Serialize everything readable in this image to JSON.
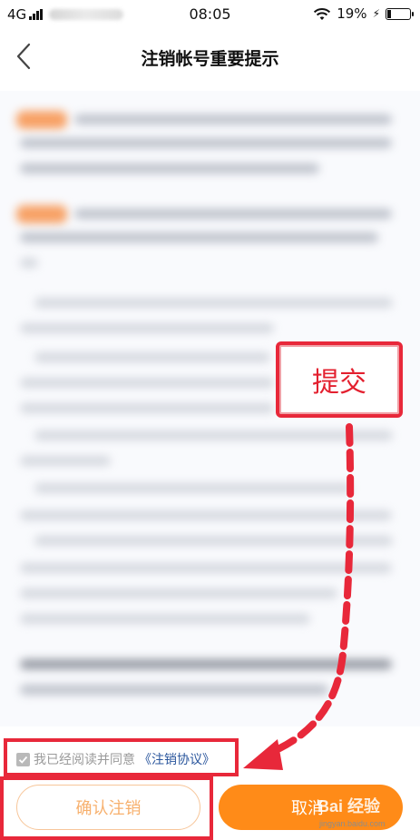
{
  "status_bar": {
    "network": "4G",
    "time": "08:05",
    "battery": "19%",
    "battery_level": 0.19
  },
  "nav": {
    "title": "注销帐号重要提示"
  },
  "annotation": {
    "label": "提交"
  },
  "agreement": {
    "checked": true,
    "text": "我已经阅读并同意",
    "link": "《注销协议》"
  },
  "buttons": {
    "confirm": "确认注销",
    "cancel": "取消"
  },
  "watermark": {
    "brand": "Bai 经验",
    "url": "jingyan.baidu.com"
  },
  "colors": {
    "accent": "#ff8b18",
    "annotation_red": "#e8283a",
    "link": "#29559c"
  }
}
